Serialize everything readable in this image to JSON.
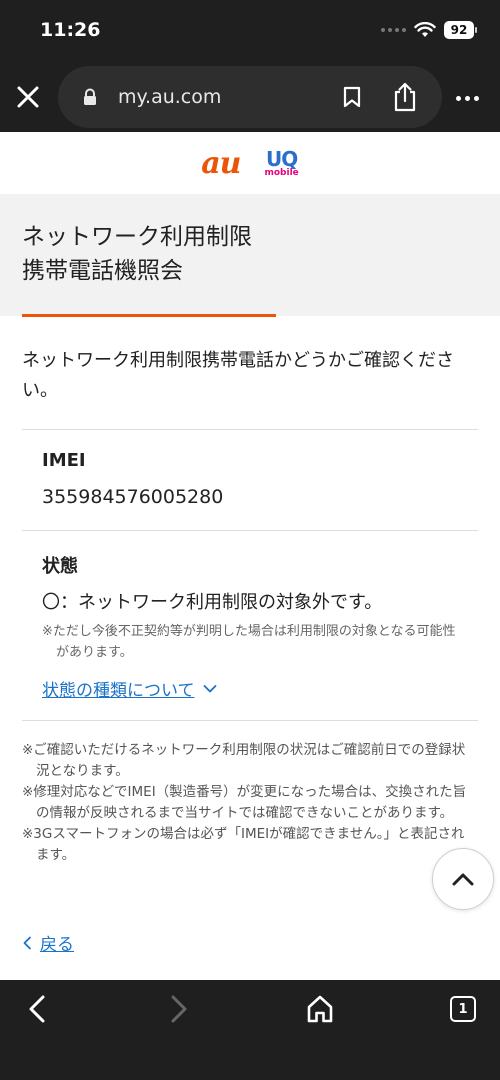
{
  "status_bar": {
    "time": "11:26",
    "battery": "92",
    "wifi_icon": "wifi-icon"
  },
  "browser": {
    "url": "my.au.com",
    "icons": [
      "close-icon",
      "lock-icon",
      "bookmark-icon",
      "share-icon",
      "more-icon"
    ]
  },
  "brand": {
    "au": "au",
    "uq": "UQ",
    "uq_sub": "mobile",
    "au_color": "#eb5505",
    "uq_color": "#2a6fc9"
  },
  "page": {
    "title_line1": "ネットワーク利用制限",
    "title_line2": "携帯電話機照会",
    "intro": "ネットワーク利用制限携帯電話かどうかご確認ください。"
  },
  "result": {
    "imei_label": "IMEI",
    "imei_value": "355984576005280",
    "status_label": "状態",
    "status_value": "〇：ネットワーク利用制限の対象外です。",
    "status_note": "※ただし今後不正契約等が判明した場合は利用制限の対象となる可能性があります。",
    "types_link": "状態の種類について"
  },
  "notes": [
    "※ご確認いただけるネットワーク利用制限の状況はご確認前日での登録状況となります。",
    "※修理対応などでIMEI（製造番号）が変更になった場合は、交換された旨の情報が反映されるまで当サイトでは確認できないことがあります。",
    "※3Gスマートフォンの場合は必ず「IMEIが確認できません。」と表記されます。"
  ],
  "back_link": "戻る",
  "bottom_nav": {
    "tab_count": "1"
  },
  "accent_color": "#eb5505",
  "link_color": "#1a73c8"
}
